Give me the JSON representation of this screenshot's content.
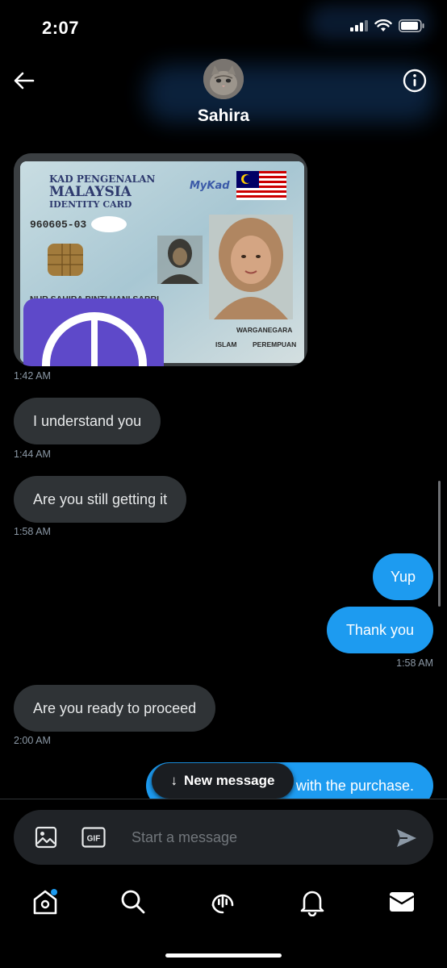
{
  "status_bar": {
    "time": "2:07"
  },
  "header": {
    "contact_name": "Sahira"
  },
  "id_card": {
    "line1": "KAD PENGENALAN",
    "line2": "MALAYSIA",
    "line3": "IDENTITY CARD",
    "brand": "MyKad",
    "number": "960605-03",
    "holder_name": "NUR SAHIRA BINTI HANI SABRI",
    "citizenship": "WARGANEGARA",
    "religion": "ISLAM",
    "gender": "PEREMPUAN"
  },
  "messages": [
    {
      "type": "image",
      "direction": "incoming",
      "time": "1:42 AM"
    },
    {
      "text": "I understand you",
      "direction": "incoming",
      "time": "1:44 AM"
    },
    {
      "text": "Are you still getting it",
      "direction": "incoming",
      "time": "1:58 AM"
    },
    {
      "text": "Yup",
      "direction": "outgoing"
    },
    {
      "text": "Thank you",
      "direction": "outgoing",
      "time": "1:58 AM"
    },
    {
      "text": "Are you ready to proceed",
      "direction": "incoming",
      "time": "2:00 AM"
    },
    {
      "text": "with the purchase.",
      "direction": "outgoing"
    }
  ],
  "new_message_pill": {
    "arrow": "↓",
    "label": "New message"
  },
  "composer": {
    "placeholder": "Start a message",
    "gif_label": "GIF"
  },
  "tabbar": {
    "items": [
      {
        "name": "home-icon",
        "has_badge": true
      },
      {
        "name": "search-icon"
      },
      {
        "name": "spaces-icon"
      },
      {
        "name": "notifications-icon"
      },
      {
        "name": "messages-icon",
        "active": true
      }
    ]
  },
  "colors": {
    "accent": "#1d9bf0",
    "incoming_bubble": "#2f3336",
    "background": "#000000"
  }
}
